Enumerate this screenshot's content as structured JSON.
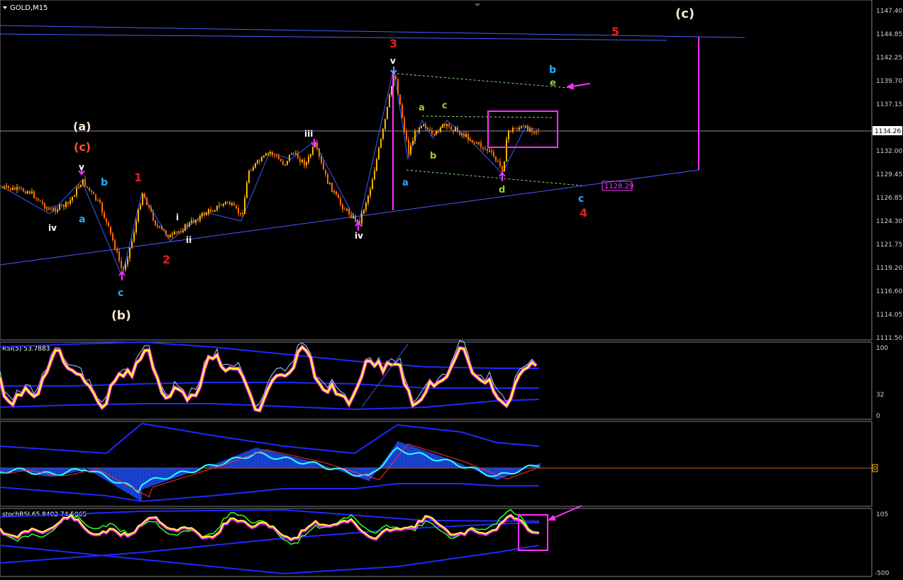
{
  "symbol_title": "GOLD,M15",
  "current_price_label": "1134.26",
  "target_price_label": "1128.29",
  "price_axis": {
    "min": 1110.5,
    "max": 1148.5,
    "ticks": [
      "1147.40",
      "1144.85",
      "1142.25",
      "1139.70",
      "1137.15",
      "1132.00",
      "1129.45",
      "1126.85",
      "1124.30",
      "1121.75",
      "1119.20",
      "1116.60",
      "1114.05",
      "1111.50"
    ]
  },
  "rsi_panel": {
    "label": "RSI(5) 53.7883",
    "ticks": [
      "100",
      "32",
      "0"
    ],
    "min": 0,
    "max": 100
  },
  "macd_panel": {
    "zero_label": "0"
  },
  "stoch_panel": {
    "label": "stochRSI 65.8402 74.5065",
    "ticks": [
      "105",
      "-500"
    ]
  },
  "wave_labels": [
    {
      "text": "(c)",
      "color": "#f5e6c8"
    },
    {
      "text": "5",
      "color": "#e02020"
    },
    {
      "text": "3",
      "color": "#e02020"
    },
    {
      "text": "v",
      "color": "#ffffff"
    },
    {
      "text": "b",
      "color": "#29aaff"
    },
    {
      "text": "e",
      "color": "#9acd32"
    },
    {
      "text": "a",
      "color": "#9acd32"
    },
    {
      "text": "c",
      "color": "#9acd32"
    },
    {
      "text": "b",
      "color": "#9acd32"
    },
    {
      "text": "a",
      "color": "#29aaff"
    },
    {
      "text": "d",
      "color": "#9acd32"
    },
    {
      "text": "c",
      "color": "#29aaff"
    },
    {
      "text": "4",
      "color": "#e02020"
    },
    {
      "text": "(a)",
      "color": "#f5e6c8"
    },
    {
      "text": "(c)",
      "color": "#ff5020"
    },
    {
      "text": "v",
      "color": "#ffffff"
    },
    {
      "text": "b",
      "color": "#29aaff"
    },
    {
      "text": "1",
      "color": "#e02020"
    },
    {
      "text": "iii",
      "color": "#ffffff"
    },
    {
      "text": "i",
      "color": "#ffffff"
    },
    {
      "text": "ii",
      "color": "#ffffff"
    },
    {
      "text": "iv",
      "color": "#ffffff"
    },
    {
      "text": "a",
      "color": "#29aaff"
    },
    {
      "text": "2",
      "color": "#e02020"
    },
    {
      "text": "iv",
      "color": "#ffffff"
    },
    {
      "text": "c",
      "color": "#29aaff"
    },
    {
      "text": "(b)",
      "color": "#f5e6c8"
    }
  ],
  "colors": {
    "background": "#000000",
    "bull_candle": "#ffb400",
    "bear_candle": "#ff6a00",
    "wave_line": "#3a5cff",
    "annotation": "#ff30ff",
    "rsi_line": "#ffff20",
    "rsi_marker": "#ff30ff"
  },
  "icons": [
    "dropdown-triangle-icon",
    "arrow-pointer-icon",
    "scroll-marker-icon"
  ]
}
